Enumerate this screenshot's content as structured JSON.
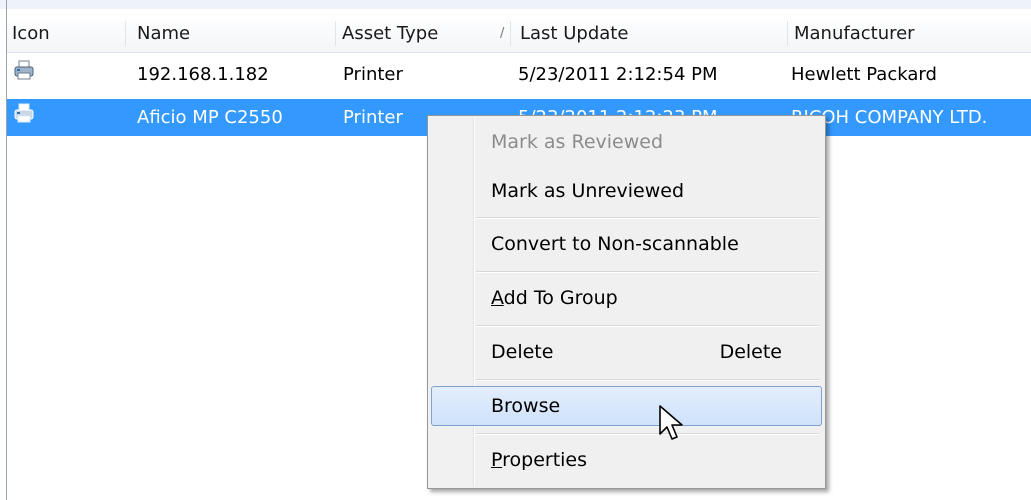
{
  "columns": [
    {
      "label": "Icon"
    },
    {
      "label": "Name"
    },
    {
      "label": "Asset Type"
    },
    {
      "label": "Last Update"
    },
    {
      "label": "Manufacturer"
    }
  ],
  "sort_glyph": "/",
  "rows": [
    {
      "icon": "printer-icon",
      "name": "192.168.1.182",
      "asset_type": "Printer",
      "last_update": "5/23/2011 2:12:54 PM",
      "manufacturer": "Hewlett Packard",
      "selected": false
    },
    {
      "icon": "printer-icon",
      "name": "Aficio MP C2550",
      "asset_type": "Printer",
      "last_update": "5/23/2011 2:12:23 PM",
      "manufacturer": "RICOH COMPANY LTD.",
      "selected": true
    }
  ],
  "context_menu": {
    "mark_reviewed": "Mark as Reviewed",
    "mark_unreviewed": "Mark as Unreviewed",
    "convert": "Convert to Non-scannable",
    "add_group_mnemonic": "A",
    "add_group_rest": "dd To Group",
    "delete": "Delete",
    "delete_shortcut": "Delete",
    "browse": "Browse",
    "properties_mnemonic": "P",
    "properties_rest": "roperties"
  },
  "colors": {
    "selection": "#3399ff",
    "menu_background": "#f0f0f0",
    "menu_hover": "#cfe2fb",
    "disabled_text": "#8c8c8c"
  },
  "cursor": "arrow-cursor-icon"
}
